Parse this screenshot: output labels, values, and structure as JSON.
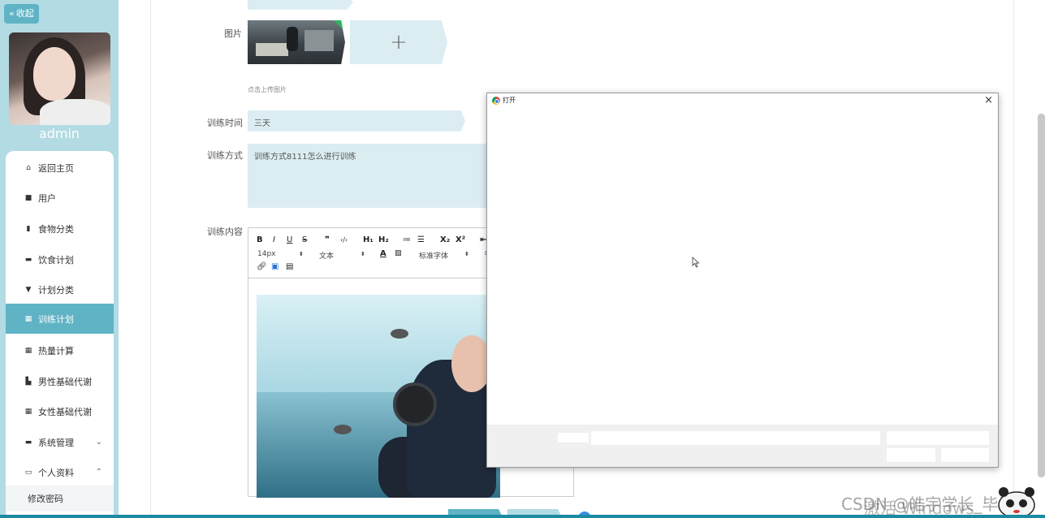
{
  "sidebar": {
    "collapse_label": "收起",
    "admin_name": "admin",
    "menu": [
      {
        "label": "返回主页",
        "icon": "home-icon"
      },
      {
        "label": "用户",
        "icon": "user-icon"
      },
      {
        "label": "食物分类",
        "icon": "bar-chart-icon"
      },
      {
        "label": "饮食计划",
        "icon": "message-icon"
      },
      {
        "label": "计划分类",
        "icon": "pin-icon"
      },
      {
        "label": "训练计划",
        "icon": "grid-icon",
        "active": true
      },
      {
        "label": "热量计算",
        "icon": "grid-icon"
      },
      {
        "label": "男性基础代谢",
        "icon": "chart-icon"
      },
      {
        "label": "女性基础代谢",
        "icon": "grid-icon"
      },
      {
        "label": "系统管理",
        "icon": "server-icon"
      },
      {
        "label": "个人资料",
        "icon": "profile-icon"
      }
    ],
    "submenu": {
      "label": "修改密码"
    }
  },
  "form": {
    "image_label": "图片",
    "upload_plus": "+",
    "upload_hint": "点击上传图片",
    "time_label": "训练时间",
    "time_value": "三天",
    "method_label": "训练方式",
    "method_value": "训练方式8111怎么进行训练",
    "content_label": "训练内容"
  },
  "editor": {
    "toolbar_row1": [
      "B",
      "I",
      "U",
      "S",
      "❞",
      "‹/›",
      "H₁",
      "H₂",
      "≔",
      "☰",
      "X₂",
      "X²"
    ],
    "font_size": "14px",
    "text_style": "文本",
    "font_family": "标准字体"
  },
  "dialog": {
    "title": "打开",
    "close": "×"
  },
  "watermarks": {
    "windows": "激活 Windows",
    "csdn": "CSDN @皓宇学长_毕设"
  },
  "colors": {
    "accent": "#5fb3c5",
    "sidebar_bg": "#b2dbe3",
    "field_bg": "#dcedf2"
  }
}
